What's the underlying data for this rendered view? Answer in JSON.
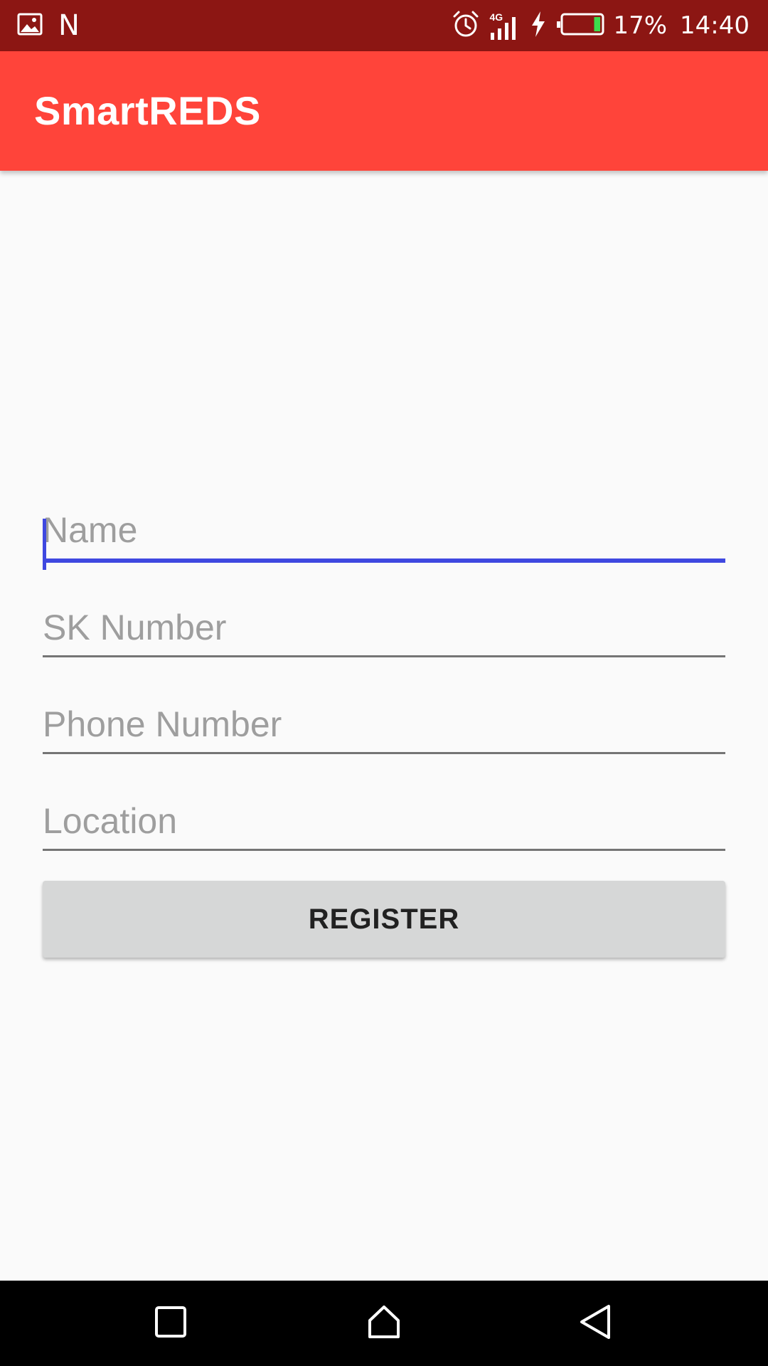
{
  "status_bar": {
    "left_icons": [
      "image-icon",
      "n-icon"
    ],
    "n_label": "N",
    "right_icons": [
      "alarm-icon",
      "signal-4g-icon",
      "charging-icon",
      "battery-icon"
    ],
    "network_label": "4G",
    "battery_percent": "17%",
    "battery_level": 0.17,
    "time": "14:40"
  },
  "app_bar": {
    "title": "SmartREDS",
    "color": "#ff443a"
  },
  "form": {
    "fields": [
      {
        "name": "name",
        "placeholder": "Name",
        "value": "",
        "focused": true
      },
      {
        "name": "sk_number",
        "placeholder": "SK Number",
        "value": "",
        "focused": false
      },
      {
        "name": "phone_number",
        "placeholder": "Phone Number",
        "value": "",
        "focused": false
      },
      {
        "name": "location",
        "placeholder": "Location",
        "value": "",
        "focused": false
      }
    ],
    "register_label": "REGISTER",
    "focus_color": "#3f48e0"
  },
  "nav_bar": {
    "buttons": [
      "recents-icon",
      "home-icon",
      "back-icon"
    ]
  }
}
